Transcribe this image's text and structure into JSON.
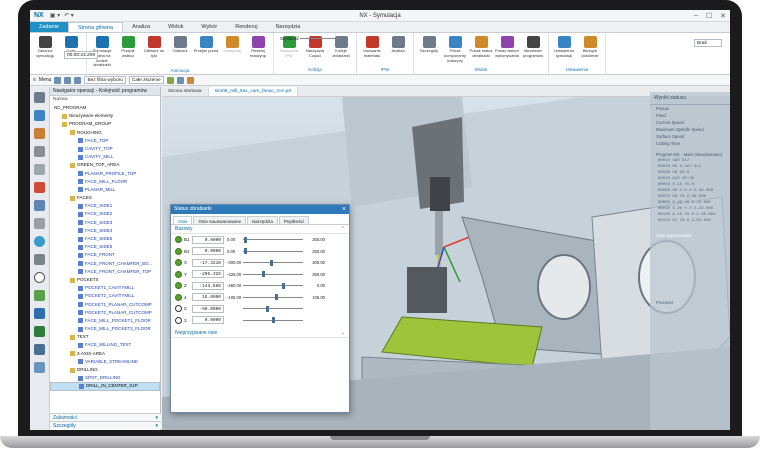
{
  "app": {
    "logo": "NX",
    "window_title": "NX - Symulacja",
    "file_tab": "Zadanie",
    "tabs": [
      "Strona główna",
      "Analiza",
      "Widok",
      "Wybór",
      "Renderuj",
      "Narzędzia"
    ],
    "active_tab": "Strona główna"
  },
  "ribbon": {
    "groups": [
      {
        "label": "",
        "buttons": [
          "Zakończ symulację",
          "Czas"
        ]
      },
      {
        "label": "Animacja",
        "buttons": [
          "Symulacja oparta na kodzie obrabiarki",
          "Przejdź wstecz",
          "Odtwórz do tyłu",
          "Odtwórz",
          "Przejdź przód",
          "Zatrzymaj",
          "Resetuj maszynę"
        ]
      },
      {
        "label": "Kolizja",
        "buttons": [
          "Narzędzia IPW",
          "Narzędzia Części",
          "Kolizje obrabiarki"
        ]
      },
      {
        "label": "IPW",
        "buttons": [
          "Usuwanie materiału",
          "Analiza"
        ]
      },
      {
        "label": "Widok",
        "buttons": [
          "Szczegóły",
          "Pokaż komponenty maszyny",
          "Pokaż status obrabiarki",
          "Pokaż wektor wykonywania",
          "Menedżer programów"
        ]
      },
      {
        "label": "Ustawienia",
        "buttons": [
          "Ustawienia symulacji",
          "Bieżące położenie"
        ]
      }
    ],
    "time_value": "00:00:23.209",
    "speed_label": "Szybkość",
    "cnc_value": "Brak"
  },
  "toolbar2": {
    "menu": "Menu",
    "filter": "Bez filtra wyboru",
    "assembly": "Całe złożenie"
  },
  "navigator": {
    "title": "Nawigator operacji - Kolejność programów",
    "col_name": "Nazwa",
    "root": "NC_PROGRAM",
    "rows": [
      {
        "text": "Nieużywane elementy",
        "level": 1,
        "type": "folder"
      },
      {
        "text": "PROGRAM_GROUP",
        "level": 1,
        "type": "folder"
      },
      {
        "text": "ROUGHING",
        "level": 2,
        "type": "folder"
      },
      {
        "text": "FACE_TOP",
        "level": 3,
        "type": "op"
      },
      {
        "text": "CAVITY_TOP",
        "level": 3,
        "type": "op"
      },
      {
        "text": "CAVITY_MILL",
        "level": 3,
        "type": "op"
      },
      {
        "text": "GREEN_TOP_AREA",
        "level": 2,
        "type": "folder"
      },
      {
        "text": "PLANAR_PROFILE_TOP",
        "level": 3,
        "type": "op"
      },
      {
        "text": "FACE_MILL_FLOOR",
        "level": 3,
        "type": "op"
      },
      {
        "text": "PLANAR_MILL",
        "level": 3,
        "type": "op"
      },
      {
        "text": "FACES",
        "level": 2,
        "type": "folder"
      },
      {
        "text": "FACE_SIDE1",
        "level": 3,
        "type": "op"
      },
      {
        "text": "FACE_SIDE2",
        "level": 3,
        "type": "op"
      },
      {
        "text": "FACE_SIDE3",
        "level": 3,
        "type": "op"
      },
      {
        "text": "FACE_SIDE4",
        "level": 3,
        "type": "op"
      },
      {
        "text": "FACE_SIDE5",
        "level": 3,
        "type": "op"
      },
      {
        "text": "FACE_SIDE6",
        "level": 3,
        "type": "op"
      },
      {
        "text": "FACE_FRONT",
        "level": 3,
        "type": "op"
      },
      {
        "text": "FACE_FRONT_CHAMFER_BO...",
        "level": 3,
        "type": "op"
      },
      {
        "text": "FACE_FRONT_CHAMFER_TOP",
        "level": 3,
        "type": "op"
      },
      {
        "text": "POCKETS",
        "level": 2,
        "type": "folder"
      },
      {
        "text": "POCKET1_CAVITYMILL",
        "level": 3,
        "type": "op"
      },
      {
        "text": "POCKET2_CAVITYMILL",
        "level": 3,
        "type": "op"
      },
      {
        "text": "POCKET1_PLANAR_CUTCOMP",
        "level": 3,
        "type": "op"
      },
      {
        "text": "POCKET2_PLANAR_CUTCOMP",
        "level": 3,
        "type": "op"
      },
      {
        "text": "FACE_MILL_POCKET1_FLOOR",
        "level": 3,
        "type": "op"
      },
      {
        "text": "FACE_MILL_POCKET2_FLOOR",
        "level": 3,
        "type": "op"
      },
      {
        "text": "TEXT",
        "level": 2,
        "type": "folder"
      },
      {
        "text": "FACE_MILLING_TEXT",
        "level": 3,
        "type": "op"
      },
      {
        "text": "3-AXIS-AREA",
        "level": 2,
        "type": "folder"
      },
      {
        "text": "VARIABLE_STREAMLINE",
        "level": 3,
        "type": "op"
      },
      {
        "text": "DRILLING",
        "level": 2,
        "type": "folder"
      },
      {
        "text": "SPOT_DRILLING",
        "level": 3,
        "type": "op"
      },
      {
        "text": "DRILL_IN_CENTER_S1P",
        "level": 3,
        "type": "op",
        "selected": true
      }
    ],
    "footer_dependency": "Zależności",
    "footer_details": "Szczegóły"
  },
  "viewtabs": [
    "Strona startowa",
    "sim08_mill_5ax_cam_fanuc_mm.prt"
  ],
  "rightpanel": {
    "title": "Wyniki statusu",
    "rows": [
      "Posuw",
      "Feed",
      "Current Speed",
      "Maximum Spindle Speed",
      "Surface Speed",
      "Cutting Time"
    ],
    "program_label": "Program NC - Main (niewykonane)",
    "code_lines": [
      "N0010 G90 G17",
      "N0020 G0 X-167.021",
      "N0030 G0 Z0.0",
      "N0040 G43 Z0 H0",
      "N0050 X-15 Y0.0",
      "N0060 X0 Y-0.0 Z-36.000",
      "N0070 X0 Y0 Z-30.000",
      "N0080 X-40 Y0 Z-24.000",
      "N0090 X-20 Y-0 Z-29.800",
      "N0100 X-15 Y0.0 Z-30.800",
      "N0110 X1 Y0.0 Z-50.000"
    ],
    "link": "Osie wyjustowanie",
    "foot": "Procesor"
  },
  "dialog": {
    "title": "Status obrabiarki",
    "tabs": [
      "Osie",
      "Osie sauowanowane",
      "Narzędzia",
      "Prędkości"
    ],
    "section": "Bazowy",
    "axes": [
      {
        "name": "B1",
        "value": "0.0000",
        "min": "0.00",
        "max": "250.00",
        "level": 0.02
      },
      {
        "name": "B2",
        "value": "0.0000",
        "min": "0.00",
        "max": "250.00",
        "level": 0.02
      },
      {
        "name": "X",
        "value": "-17.3210",
        "min": "-300.00",
        "max": "300.00",
        "level": 0.47
      },
      {
        "name": "Y",
        "value": "-205.325",
        "min": "-425.00",
        "max": "250.00",
        "level": 0.33
      },
      {
        "name": "Z",
        "value": "-143.886",
        "min": "-450.00",
        "max": "0.00",
        "level": 0.68
      },
      {
        "name": "4",
        "value": "15.0000",
        "min": "-105.00",
        "max": "105.00",
        "level": 0.57
      },
      {
        "name": "C",
        "value": "-90.0000",
        "min": "",
        "max": "",
        "level": 0.4
      },
      {
        "name": "3",
        "value": "0.0000",
        "min": "",
        "max": "",
        "level": 0.5
      }
    ],
    "section2": "Nieprzypisane osie"
  }
}
